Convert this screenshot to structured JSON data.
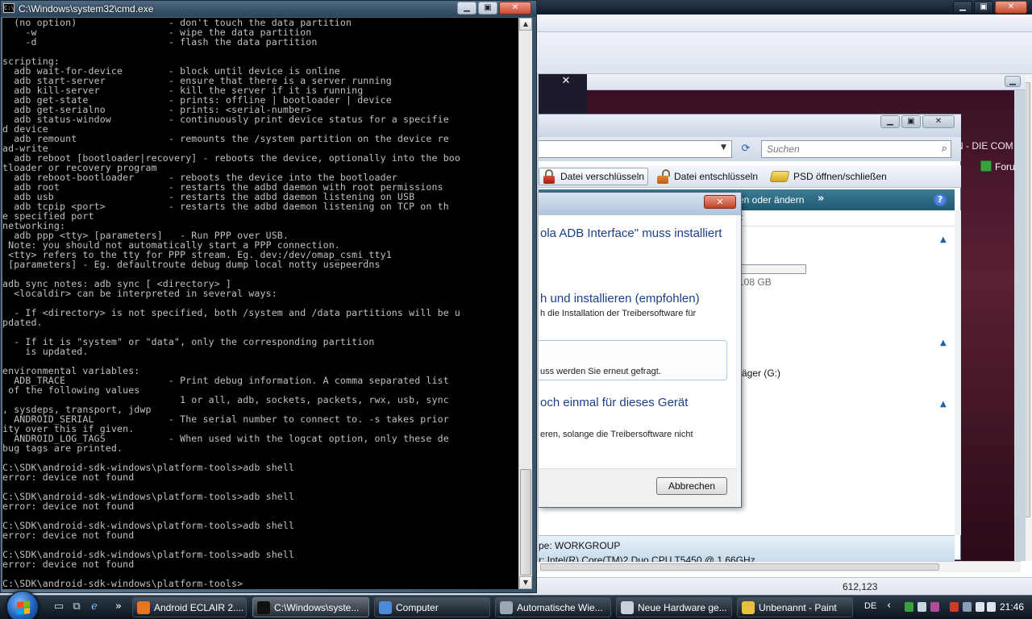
{
  "cmd": {
    "title": "C:\\Windows\\system32\\cmd.exe",
    "icon_label": "C:\\",
    "lines": [
      "  (no option)                - don't touch the data partition",
      "    -w                       - wipe the data partition",
      "    -d                       - flash the data partition",
      "",
      "scripting:",
      "  adb wait-for-device        - block until device is online",
      "  adb start-server           - ensure that there is a server running",
      "  adb kill-server            - kill the server if it is running",
      "  adb get-state              - prints: offline | bootloader | device",
      "  adb get-serialno           - prints: <serial-number>",
      "  adb status-window          - continuously print device status for a specifie",
      "d device",
      "  adb remount                - remounts the /system partition on the device re",
      "ad-write",
      "  adb reboot [bootloader|recovery] - reboots the device, optionally into the boo",
      "tloader or recovery program",
      "  adb reboot-bootloader      - reboots the device into the bootloader",
      "  adb root                   - restarts the adbd daemon with root permissions",
      "  adb usb                    - restarts the adbd daemon listening on USB",
      "  adb tcpip <port>           - restarts the adbd daemon listening on TCP on th",
      "e specified port",
      "networking:",
      "  adb ppp <tty> [parameters]   - Run PPP over USB.",
      " Note: you should not automatically start a PPP connection.",
      " <tty> refers to the tty for PPP stream. Eg. dev:/dev/omap_csmi_tty1",
      " [parameters] - Eg. defaultroute debug dump local notty usepeerdns",
      "",
      "adb sync notes: adb sync [ <directory> ]",
      "  <localdir> can be interpreted in several ways:",
      "",
      "  - If <directory> is not specified, both /system and /data partitions will be u",
      "pdated.",
      "",
      "  - If it is \"system\" or \"data\", only the corresponding partition",
      "    is updated.",
      "",
      "environmental variables:",
      "  ADB_TRACE                  - Print debug information. A comma separated list",
      " of the following values",
      "                               1 or all, adb, sockets, packets, rwx, usb, sync",
      ", sysdeps, transport, jdwp",
      "  ANDROID_SERIAL             - The serial number to connect to. -s takes prior",
      "ity over this if given.",
      "  ANDROID_LOG_TAGS           - When used with the logcat option, only these de",
      "bug tags are printed.",
      "",
      "C:\\SDK\\android-sdk-windows\\platform-tools>adb shell",
      "error: device not found",
      "",
      "C:\\SDK\\android-sdk-windows\\platform-tools>adb shell",
      "error: device not found",
      "",
      "C:\\SDK\\android-sdk-windows\\platform-tools>adb shell",
      "error: device not found",
      "",
      "C:\\SDK\\android-sdk-windows\\platform-tools>adb shell",
      "error: device not found",
      "",
      "C:\\SDK\\android-sdk-windows\\platform-tools>"
    ]
  },
  "browser": {
    "banner_text": "N - DIE COM",
    "forum_label": "Foru"
  },
  "explorer": {
    "search_placeholder": "Suchen",
    "cmd_encrypt": "Datei verschlüsseln",
    "cmd_decrypt": "Datei entschlüsseln",
    "cmd_psd": "PSD öffnen/schließen",
    "task_text": "en oder ändern",
    "task_chevron": "»",
    "help_label": "?",
    "col_header": "z",
    "drive_size": "108 GB",
    "drive_g": "räger (G:)",
    "workgroup": "pe: WORKGROUP",
    "cpu": "r: Intel(R) Core(TM)2 Duo CPU     T5450  @ 1.66GHz"
  },
  "dialog": {
    "headline": "ola ADB Interface\" muss installiert",
    "opt1_title": "h und installieren (empfohlen)",
    "opt1_desc": "h die Installation der Treibersoftware für",
    "opt2_desc": "uss werden Sie erneut gefragt.",
    "opt3_title": "och einmal für dieses Gerät",
    "opt3_desc": "eren, solange die Treibersoftware nicht",
    "cancel_label": "Abbrechen"
  },
  "paint": {
    "status_coords": "612,123"
  },
  "taskbar": {
    "items": [
      {
        "label": "Android ECLAIR 2....",
        "color": "#e8761c"
      },
      {
        "label": "C:\\Windows\\syste...",
        "color": "#111111"
      },
      {
        "label": "Computer",
        "color": "#4a8ad8"
      },
      {
        "label": "Automatische Wie...",
        "color": "#9aa8b6"
      },
      {
        "label": "Neue Hardware ge...",
        "color": "#c8d0dc"
      },
      {
        "label": "Unbenannt - Paint",
        "color": "#e8c040"
      }
    ],
    "tray_lang": "DE",
    "tray_chevron": "‹",
    "clock": "21:46"
  }
}
